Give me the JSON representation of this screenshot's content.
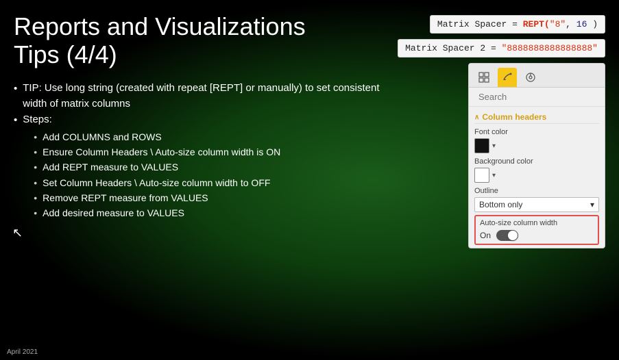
{
  "title": {
    "line1": "Reports and Visualizations",
    "line2": "Tips (4/4)"
  },
  "bullets": [
    {
      "text": "TIP: Use long string (created with repeat [REPT] or manually) to set consistent width of matrix columns"
    },
    {
      "text": "Steps:",
      "sub": [
        "Add COLUMNS and ROWS",
        "Ensure Column Headers \\ Auto-size column width is ON",
        "Add REPT measure to VALUES",
        "Set Column Headers \\ Auto-size column width to OFF",
        "Remove REPT measure from VALUES",
        "Add desired measure to VALUES"
      ]
    }
  ],
  "formula1": {
    "prefix": "Matrix Spacer = ",
    "fn": "REPT(",
    "arg1": "\"8\"",
    "sep": ", ",
    "arg2": "16",
    "close": " )"
  },
  "formula2": {
    "prefix": "Matrix Spacer 2 = ",
    "value": "\"8888888888888888\""
  },
  "panel": {
    "tabs": [
      {
        "icon": "⊞",
        "label": "fields-tab",
        "active": false
      },
      {
        "icon": "🖌",
        "label": "format-tab",
        "active": true
      },
      {
        "icon": "🔍",
        "label": "analytics-tab",
        "active": false
      }
    ],
    "search_placeholder": "Search",
    "section_label": "Column headers",
    "font_color_label": "Font color",
    "bg_color_label": "Background color",
    "outline_label": "Outline",
    "outline_value": "Bottom only",
    "auto_size_label": "Auto-size column width",
    "toggle_label": "On",
    "toggle_on": true
  },
  "footer": "April 2021"
}
